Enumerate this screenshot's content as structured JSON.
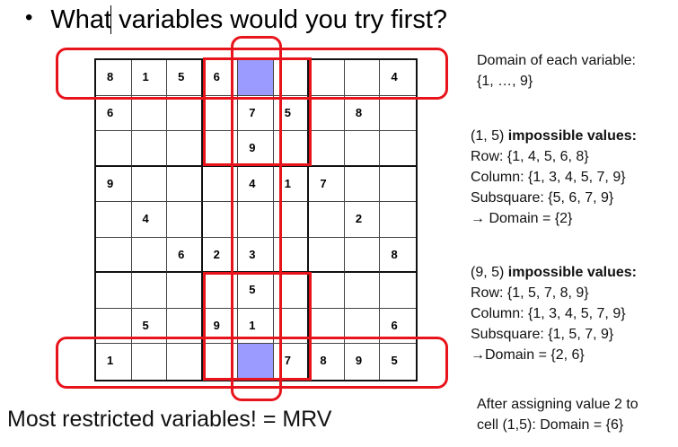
{
  "heading": {
    "bullet": "•",
    "text": "What variables would you try first?"
  },
  "sudoku": {
    "rows": [
      [
        "8",
        "1",
        "5",
        "6",
        "",
        "",
        "",
        "",
        "4"
      ],
      [
        "6",
        "",
        "",
        "",
        "7",
        "5",
        "",
        "8",
        ""
      ],
      [
        "",
        "",
        "",
        "",
        "9",
        "",
        "",
        "",
        ""
      ],
      [
        "9",
        "",
        "",
        "",
        "4",
        "1",
        "7",
        "",
        ""
      ],
      [
        "",
        "4",
        "",
        "",
        "",
        "",
        "",
        "2",
        ""
      ],
      [
        "",
        "",
        "6",
        "2",
        "3",
        "",
        "",
        "",
        "8"
      ],
      [
        "",
        "",
        "",
        "",
        "5",
        "",
        "",
        "",
        ""
      ],
      [
        "",
        "5",
        "",
        "9",
        "1",
        "",
        "",
        "",
        "6"
      ],
      [
        "1",
        "",
        "",
        "",
        "",
        "7",
        "8",
        "9",
        "5"
      ]
    ],
    "highlighted_cells": [
      [
        1,
        5
      ],
      [
        9,
        5
      ]
    ],
    "highlight_color": "#9b9bff",
    "annotation_color": "#e8141c"
  },
  "side_notes": {
    "domain_title": "Domain of each variable:",
    "domain_value": "{1, …, 9}",
    "cell15": {
      "cell": "(1, 5)",
      "title": "impossible values:",
      "row": "Row: {1, 4, 5, 6, 8}",
      "column": "Column: {1, 3, 4, 5, 7, 9}",
      "subsquare": "Subsquare: {5, 6, 7, 9}",
      "domain": "→ Domain = {2}"
    },
    "cell95": {
      "cell": "(9, 5)",
      "title": "impossible values:",
      "row": "Row: {1, 5, 7, 8, 9}",
      "column": "Column: {1, 3, 4, 5, 7, 9}",
      "subsquare": "Subsquare: {1, 5, 7, 9}",
      "domain": "→Domain = {2, 6}"
    },
    "after_line1": "After assigning value 2 to",
    "after_line2": "cell (1,5):  Domain = {6}"
  },
  "footer": {
    "text": "Most restricted variables! = MRV"
  }
}
